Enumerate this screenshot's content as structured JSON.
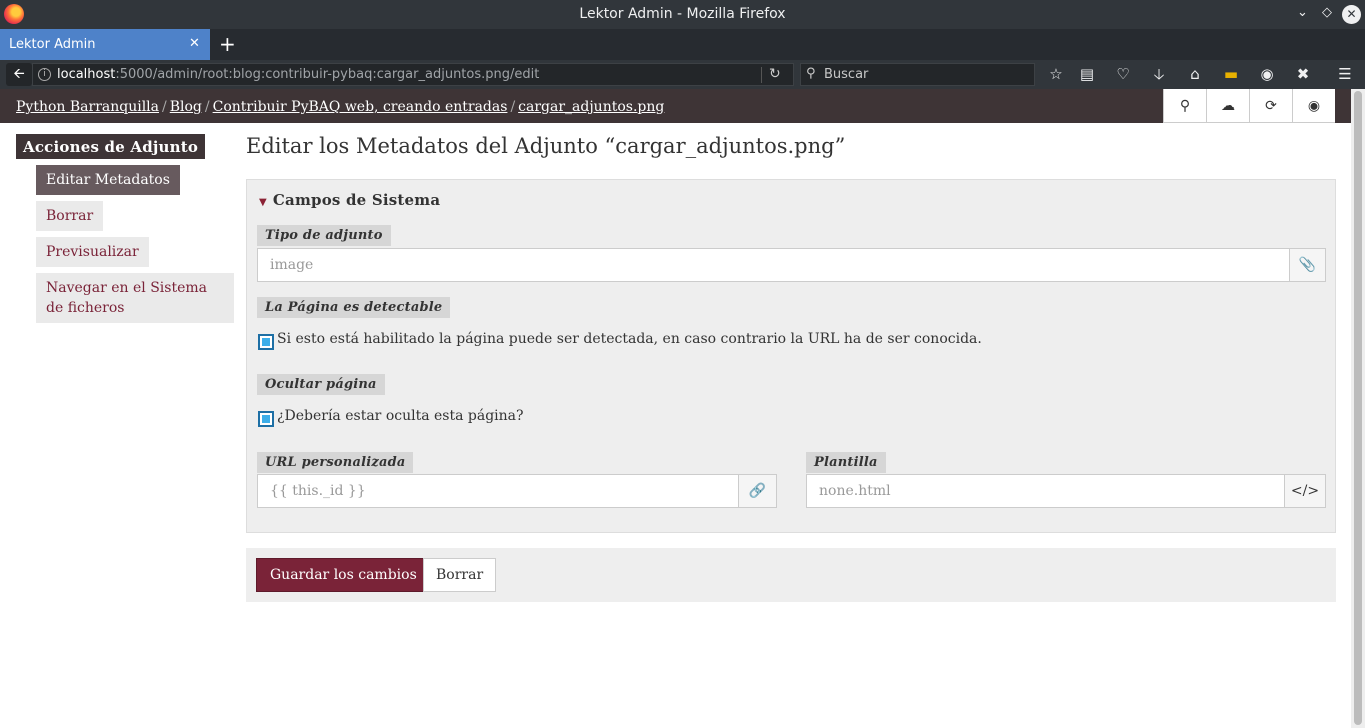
{
  "window": {
    "title": "Lektor Admin - Mozilla Firefox"
  },
  "browser": {
    "tab_label": "Lektor Admin",
    "url_host": "localhost",
    "url_rest": ":5000/admin/root:blog:contribuir-pybaq:cargar_adjuntos.png/edit",
    "search_placeholder": "Buscar"
  },
  "header": {
    "breadcrumbs": [
      "Python Barranquilla",
      "Blog",
      "Contribuir PyBAQ web, creando entradas",
      "cargar_adjuntos.png"
    ]
  },
  "sidebar": {
    "title": "Acciones de Adjunto",
    "items": [
      {
        "label": "Editar Metadatos"
      },
      {
        "label": "Borrar"
      },
      {
        "label": "Previsualizar"
      },
      {
        "label": "Navegar en el Sistema de ficheros"
      }
    ]
  },
  "main": {
    "title": "Editar los Metadatos del Adjunto “cargar_adjuntos.png”",
    "section_title": "Campos de Sistema",
    "fields": {
      "tipo": {
        "label": "Tipo de adjunto",
        "value": "image"
      },
      "detectable": {
        "label": "La Página es detectable",
        "checkbox_label": "Si esto está habilitado la página puede ser detectada, en caso contrario la URL ha de ser conocida.",
        "checked": true
      },
      "ocultar": {
        "label": "Ocultar página",
        "checkbox_label": "¿Debería estar oculta esta página?",
        "checked": true
      },
      "url": {
        "label": "URL personalizada",
        "placeholder": "{{ this._id }}"
      },
      "plantilla": {
        "label": "Plantilla",
        "placeholder": "none.html"
      }
    },
    "buttons": {
      "save": "Guardar los cambios",
      "delete": "Borrar"
    }
  },
  "colors": {
    "accent": "#7a2338",
    "header_bg": "#3e3436",
    "tab_active": "#4e82c9"
  }
}
